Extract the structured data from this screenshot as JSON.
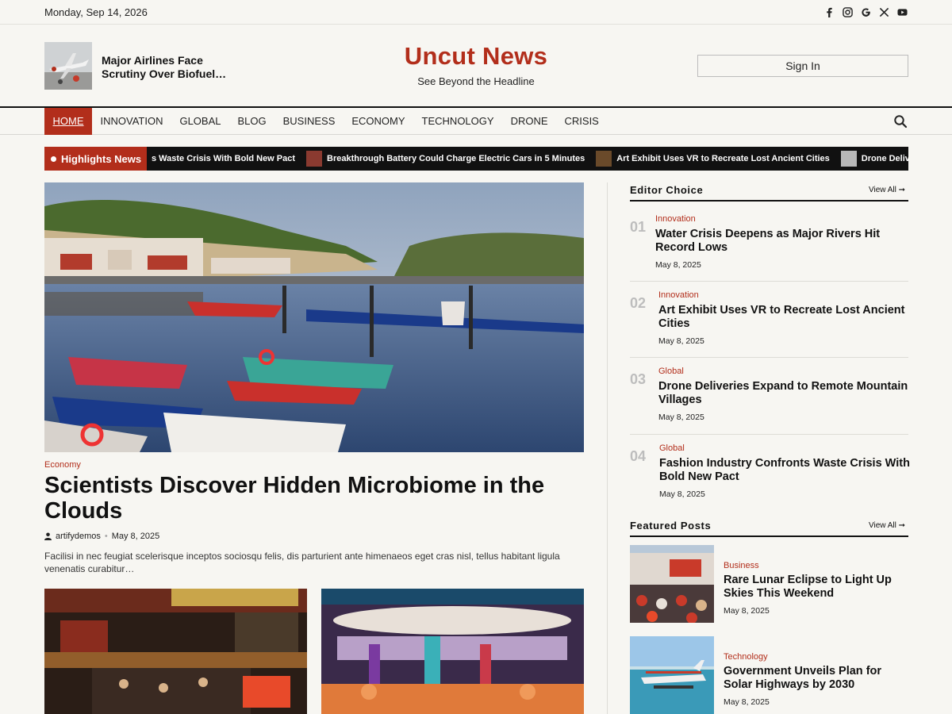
{
  "topbar": {
    "date": "Monday, Sep 14, 2026",
    "social_icons": [
      "facebook-icon",
      "instagram-icon",
      "google-icon",
      "x-icon",
      "youtube-icon"
    ]
  },
  "header": {
    "featured_title": "Major Airlines Face Scrutiny Over Biofuel…",
    "brand_name": "Uncut News",
    "tagline": "See Beyond the Headline",
    "signin_label": "Sign In"
  },
  "nav": {
    "items": [
      "HOME",
      "INNOVATION",
      "GLOBAL",
      "BLOG",
      "BUSINESS",
      "ECONOMY",
      "TECHNOLOGY",
      "DRONE",
      "CRISIS"
    ],
    "active": "HOME",
    "search_icon": "search-icon"
  },
  "ticker": {
    "label": "Highlights News",
    "items": [
      "s Waste Crisis With Bold New Pact",
      "Breakthrough Battery Could Charge Electric Cars in 5 Minutes",
      "Art Exhibit Uses VR to Recreate Lost Ancient Cities",
      "Drone Deliveries Expand to Remote Mountain Villages"
    ]
  },
  "hero": {
    "category": "Economy",
    "title": "Scientists Discover Hidden Microbiome in the Clouds",
    "author": "artifydemos",
    "date": "May 8, 2025",
    "excerpt": "Facilisi in nec feugiat scelerisque inceptos sociosqu felis, dis parturient ante himenaeos eget cras nisl, tellus habitant ligula venenatis curabitur…"
  },
  "editor_choice": {
    "title": "Editor Choice",
    "view_all": "View All",
    "items": [
      {
        "num": "01",
        "category": "Innovation",
        "title": "Water Crisis Deepens as Major Rivers Hit Record Lows",
        "date": "May 8, 2025"
      },
      {
        "num": "02",
        "category": "Innovation",
        "title": "Art Exhibit Uses VR to Recreate Lost Ancient Cities",
        "date": "May 8, 2025"
      },
      {
        "num": "03",
        "category": "Global",
        "title": "Drone Deliveries Expand to Remote Mountain Villages",
        "date": "May 8, 2025"
      },
      {
        "num": "04",
        "category": "Global",
        "title": "Fashion Industry Confronts Waste Crisis With Bold New Pact",
        "date": "May 8, 2025"
      }
    ]
  },
  "featured_posts": {
    "title": "Featured Posts",
    "view_all": "View All",
    "items": [
      {
        "category": "Business",
        "title": "Rare Lunar Eclipse to Light Up Skies This Weekend",
        "date": "May 8, 2025"
      },
      {
        "category": "Technology",
        "title": "Government Unveils Plan for Solar Highways by 2030",
        "date": "May 8, 2025"
      }
    ]
  },
  "colors": {
    "accent": "#b22e1b",
    "background": "#f7f6f2",
    "ticker_bg": "#111111"
  }
}
